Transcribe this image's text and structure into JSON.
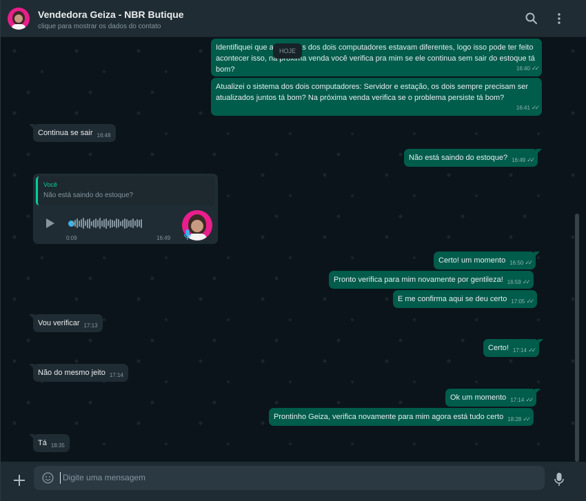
{
  "header": {
    "title": "Vendedora Geiza - NBR Butique",
    "subtitle": "clique para mostrar os dados do contato"
  },
  "day_chip": "HOJE",
  "messages": [
    {
      "dir": "out",
      "text": "Identifiquei que as versões dos dois computadores estavam diferentes, logo isso pode ter feito acontecer isso, na próxima venda você verifica pra mim se ele continua sem sair do estoque tá bom?",
      "time": "16:40"
    },
    {
      "dir": "out",
      "text": "Atualizei o sistema dos dois computadores: Servidor e estação, os dois sempre precisam ser atualizados juntos tá bom? Na próxima venda verifica se o problema persiste tá bom?",
      "time": "16:41"
    },
    {
      "dir": "in",
      "text": "Continua se sair",
      "time": "16:48"
    },
    {
      "dir": "out",
      "text": "Não está saindo do estoque?",
      "time": "16:49"
    },
    {
      "dir": "out",
      "text": "Certo! um momento",
      "time": "16:50"
    },
    {
      "dir": "out",
      "text": "Pronto verifica para mim novamente por gentileza!",
      "time": "16:59"
    },
    {
      "dir": "out",
      "text": "E me confirma aqui se deu certo",
      "time": "17:05"
    },
    {
      "dir": "in",
      "text": "Vou verificar",
      "time": "17:13"
    },
    {
      "dir": "out",
      "text": "Certo!",
      "time": "17:14"
    },
    {
      "dir": "in",
      "text": "Não do mesmo jeito",
      "time": "17:14"
    },
    {
      "dir": "out",
      "text": "Ok um momento",
      "time": "17:14"
    },
    {
      "dir": "out",
      "text": "Prontinho Geiza, verifica novamente para mim agora está tudo certo",
      "time": "18:28"
    },
    {
      "dir": "in",
      "text": "Tá",
      "time": "18:35"
    }
  ],
  "voice_note": {
    "quote_author": "Você",
    "quote_text": "Não está saindo do estoque?",
    "duration": "0:09",
    "time": "16:49"
  },
  "composer": {
    "placeholder": "Digite uma mensagem"
  },
  "colors": {
    "outgoing_bubble": "#005c4b",
    "incoming_bubble": "#202c33",
    "background": "#0b141a",
    "accent": "#06cf9c"
  }
}
